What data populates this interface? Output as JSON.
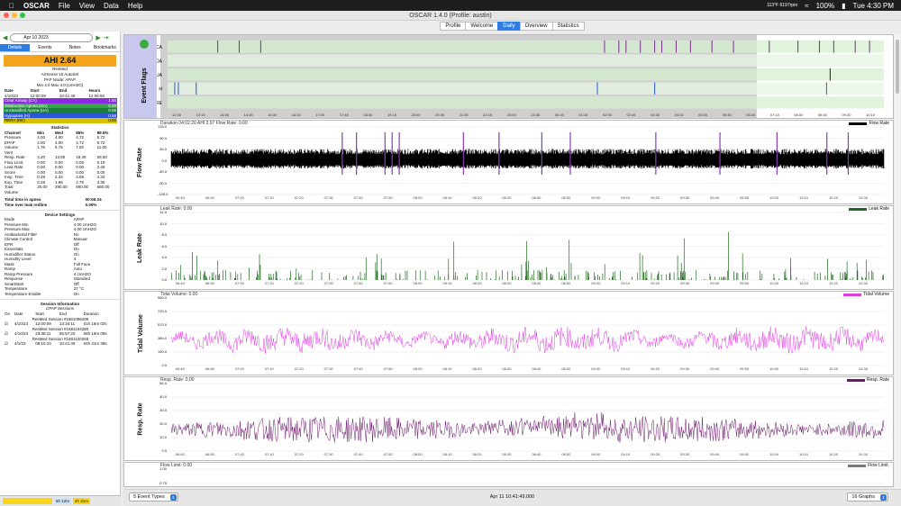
{
  "menubar": {
    "app": "OSCAR",
    "items": [
      "File",
      "View",
      "Data",
      "Help"
    ],
    "status_small": "113°F 6197rpm",
    "battery": "100%",
    "clock": "Tue 4:30 PM"
  },
  "window": {
    "title": "OSCAR 1.4.0 (Profile: austin)"
  },
  "tabs": [
    "Profile",
    "Welcome",
    "Daily",
    "Overview",
    "Statistics"
  ],
  "sidebar": {
    "date": "Apr 10 2023",
    "tabs": [
      "Details",
      "Events",
      "Notes",
      "Bookmarks"
    ],
    "ahi": "AHI 2.64",
    "machine": [
      "ResMed",
      "AirSense 10 AutoSet",
      "PAP Mode: APAP",
      "Min 4.0 Max 4.0 (cmH2O)"
    ],
    "session_head": [
      "Date",
      "Start",
      "End",
      "Hours"
    ],
    "session_row": [
      "4/10/23",
      "12:00:09",
      "10:41:49",
      "12:06:50"
    ],
    "events": [
      {
        "name": "Clear Airway (CA)",
        "value": "1.50",
        "color": "#8a2be2"
      },
      {
        "name": "Obstructive Apnea (OA)",
        "value": "0.00",
        "color": "#38a34a"
      },
      {
        "name": "Unclassified Apnea (UA)",
        "value": "0.08",
        "color": "#1a7f3c"
      },
      {
        "name": "Hypopnea (H)",
        "value": "0.58",
        "color": "#2b57d6"
      },
      {
        "name": "RERA (RE)",
        "value": "0.00",
        "color": "#d8c000"
      }
    ],
    "stats_title": "Statistics",
    "stats_head": [
      "Channel",
      "Min",
      "Med",
      "95%",
      "99.5%"
    ],
    "stats": [
      [
        "Pressure",
        "4.00",
        "4.00",
        "4.72",
        "5.72"
      ],
      [
        "EPAP",
        "4.00",
        "4.00",
        "4.72",
        "5.72"
      ],
      [
        "Volume",
        "1.76",
        "5.76",
        "7.50",
        "11.00"
      ],
      [
        "Vent",
        "",
        "",
        "",
        ""
      ],
      [
        "Resp. Rate",
        "4.20",
        "13.80",
        "19.40",
        "28.60"
      ],
      [
        "Flow Limit.",
        "0.00",
        "0.00",
        "0.06",
        "0.19"
      ],
      [
        "Leak Rate",
        "0.00",
        "0.00",
        "0.00",
        "2.40"
      ],
      [
        "Snore",
        "0.00",
        "0.00",
        "0.00",
        "0.00"
      ],
      [
        "Insp. Time",
        "0.28",
        "2.34",
        "3.58",
        "4.34"
      ],
      [
        "Exp. Time",
        "0.28",
        "1.96",
        "2.76",
        "3.36"
      ],
      [
        "Total",
        "20.00",
        "390.00",
        "560.00",
        "680.00"
      ],
      [
        "Volume",
        "",
        "",
        "",
        ""
      ]
    ],
    "apnea_time_label": "Total time in apnea",
    "apnea_time": "00:06:24",
    "leak_time_label": "Time over leak redline",
    "leak_time": "0.00%",
    "device_title": "Device Settings",
    "device": [
      [
        "Mode",
        "APAP"
      ],
      [
        "Pressure Min",
        "4.00 cmH2O"
      ],
      [
        "Pressure Max",
        "4.00 cmH2O"
      ],
      [
        "Antibacterial Filter",
        "No"
      ],
      [
        "Climate Control",
        "Manual"
      ],
      [
        "EPR",
        "Off"
      ],
      [
        "Essentials",
        "On"
      ],
      [
        "Humidifier Status",
        "On"
      ],
      [
        "Humidity Level",
        "4"
      ],
      [
        "Mask",
        "Full Face"
      ],
      [
        "Ramp",
        "Auto"
      ],
      [
        "Ramp Pressure",
        "4 cmH2O"
      ],
      [
        "Response",
        "Standard"
      ],
      [
        "SmartStart",
        "Off"
      ],
      [
        "Temperature",
        "27 °C"
      ],
      [
        "Temperature Enable",
        "On"
      ]
    ],
    "session_info_title": "Session Information",
    "cpap_title": "CPAP Sessions",
    "cpap_head": [
      "On",
      "Date",
      "Start",
      "End",
      "Duration"
    ],
    "cpap": [
      {
        "label": "ResMed Session #1681096208",
        "date": "4/10/23",
        "start": "12:00:09",
        "end": "13:16:11",
        "dur": "01h 16m 02s"
      },
      {
        "label": "ResMed Session #1681104280",
        "date": "4/10/23",
        "start": "23:38:11",
        "end": "05:57:20",
        "dur": "06h 19m 09s"
      },
      {
        "label": "ResMed Session #1681120265",
        "date": "4/1/23",
        "start": "06:10:10",
        "end": "10:41:49",
        "dur": "04h 31m 39s"
      }
    ],
    "foot_a": "6h 12m",
    "foot_b": "4h 31m"
  },
  "graphs": {
    "flags": {
      "title": "Event Flags",
      "rows": [
        "CA",
        "OA",
        "UA",
        "H",
        "RE"
      ],
      "ticks": [
        "12:30",
        "13:15",
        "14:00",
        "14:45",
        "15:30",
        "16:15",
        "17:00",
        "17:45",
        "18:30",
        "19:15",
        "20:00",
        "20:45",
        "21:30",
        "22:15",
        "23:00",
        "23:45",
        "00:30",
        "01:15",
        "02:00",
        "02:45",
        "03:30",
        "04:15",
        "05:00",
        "05:45",
        "06:30",
        "07:15",
        "08:00",
        "08:45",
        "09:30",
        "10:15"
      ]
    },
    "flow": {
      "title": "Flow Rate",
      "header": "Duration 04:02:20 AHI 2.97 Flow Rate: 0.00",
      "legend": "Flow Rate",
      "y": [
        "135.0",
        "90.0",
        "45.0",
        "0.0",
        "-45.0",
        "-90.0",
        "-135.0"
      ]
    },
    "leak": {
      "title": "Leak Rate",
      "header": "Leak Rate: 0.00",
      "legend": "Leak Rate",
      "y": [
        "12.0",
        "10.0",
        "8.0",
        "6.0",
        "4.0",
        "2.0",
        "0.0"
      ]
    },
    "tidal": {
      "title": "Tidal Volume",
      "header": "Tidal Volume: 0.00",
      "legend": "Tidal Volume",
      "y": [
        "960.0",
        "720.0",
        "570.0",
        "380.0",
        "190.0",
        "0.0"
      ]
    },
    "resp": {
      "title": "Resp. Rate",
      "header": "Resp. Rate: 0.00",
      "legend": "Resp. Rate",
      "y": [
        "50.0",
        "40.0",
        "30.0",
        "20.0",
        "10.0",
        "0.0"
      ]
    },
    "flowlim": {
      "title": "",
      "header": "Flow Limit: 0.00",
      "legend": "Flow Limit.",
      "y": [
        "1.00",
        "0.75"
      ]
    },
    "ticks": [
      "06:40",
      "06:50",
      "07:00",
      "07:10",
      "07:20",
      "07:30",
      "07:40",
      "07:50",
      "08:00",
      "08:10",
      "08:20",
      "08:30",
      "08:40",
      "08:50",
      "09:00",
      "09:10",
      "09:20",
      "09:30",
      "09:40",
      "09:50",
      "10:00",
      "10:10",
      "10:20",
      "10:30"
    ]
  },
  "bottom": {
    "event_types": "5 Event Types",
    "timestamp": "Apr 11 10:41:49.000",
    "graphs": "16 Graphs"
  }
}
